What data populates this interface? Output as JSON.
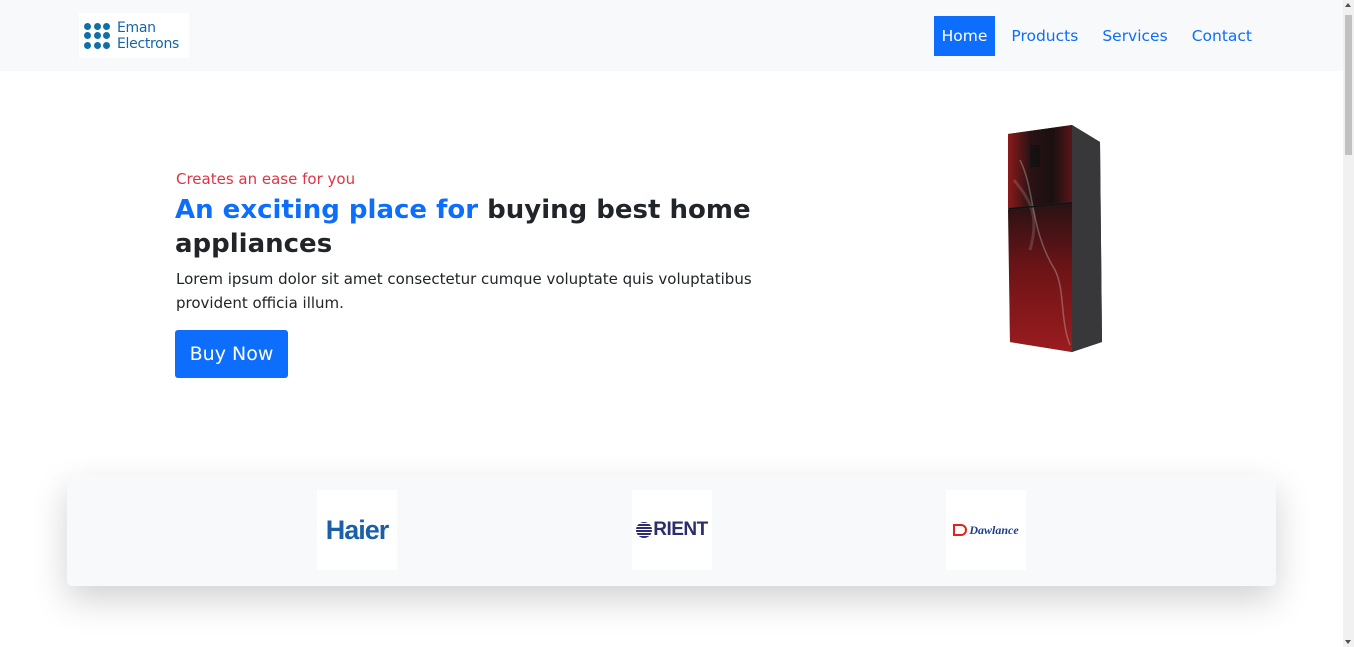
{
  "brand": {
    "line1": "Eman",
    "line2": "Electrons",
    "color": "#1565a8"
  },
  "nav": {
    "items": [
      {
        "label": "Home",
        "active": true
      },
      {
        "label": "Products",
        "active": false
      },
      {
        "label": "Services",
        "active": false
      },
      {
        "label": "Contact",
        "active": false
      }
    ]
  },
  "hero": {
    "kicker": "Creates an ease for you",
    "title_accent": "An exciting place for",
    "title_rest": "buying best home appliances",
    "description": "Lorem ipsum dolor sit amet consectetur cumque voluptate quis voluptatibus provident officia illum.",
    "cta_label": "Buy Now",
    "image": "refrigerator-image"
  },
  "brands": [
    {
      "name": "Haier"
    },
    {
      "name": "RIENT"
    },
    {
      "name": "Dawlance"
    }
  ],
  "colors": {
    "primary": "#0d6efd",
    "kicker": "#dc3545",
    "navbar_bg": "#f8f9fa"
  }
}
